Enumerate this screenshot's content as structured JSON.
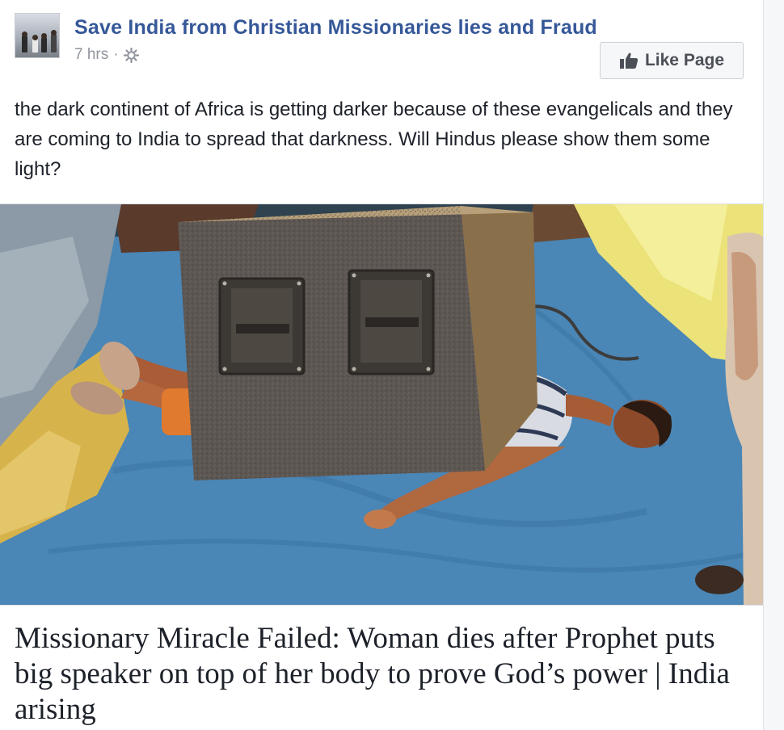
{
  "post": {
    "page_name": "Save India from Christian Missionaries lies and Fraud",
    "timestamp": "7 hrs",
    "separator": "·",
    "privacy_icon": "public-globe-icon",
    "like_button": {
      "label": "Like Page",
      "icon": "thumbs-up-icon"
    },
    "text": "the dark continent of Africa is getting darker because of these evangelicals and they are coming to India to spread that darkness. Will Hindus please show them some light?",
    "link_preview": {
      "title": "Missionary Miracle Failed: Woman dies after Prophet puts big speaker on top of her body to prove God’s power | India arising"
    }
  },
  "colors": {
    "link_blue": "#365899",
    "meta_gray": "#90949c",
    "text_dark": "#1d2129",
    "button_bg": "#f6f7f9",
    "button_border": "#ced0d4"
  }
}
